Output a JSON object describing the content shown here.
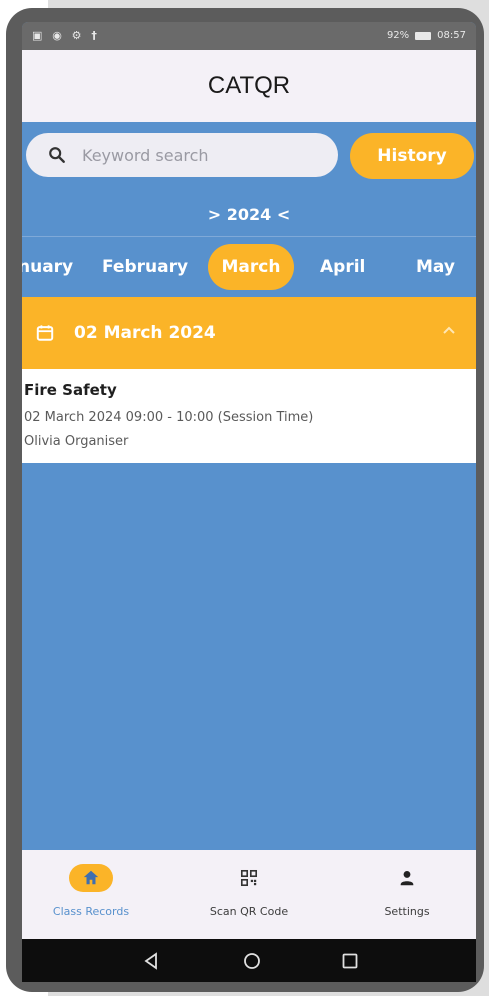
{
  "statusbar": {
    "left_icons": "▣ ◉ ⚙ †",
    "battery": "92%",
    "time": "08:57"
  },
  "app": {
    "title": "CATQR"
  },
  "search": {
    "placeholder": "Keyword search"
  },
  "history_button": "History",
  "year_selector": "> 2024 <",
  "months": [
    "nuary",
    "February",
    "March",
    "April",
    "May"
  ],
  "selected_month": "March",
  "section": {
    "date": "02 March 2024"
  },
  "record": {
    "title": "Fire Safety",
    "session": "02 March 2024 09:00 - 10:00 (Session Time)",
    "organiser": "Olivia Organiser"
  },
  "bottom_nav": [
    {
      "label": "Class Records",
      "icon": "home-icon",
      "active": true
    },
    {
      "label": "Scan QR Code",
      "icon": "qr-code-icon",
      "active": false
    },
    {
      "label": "Settings",
      "icon": "person-icon",
      "active": false
    }
  ],
  "colors": {
    "accent": "#fbb428",
    "primary": "#5891cd",
    "surface": "#f4f1f7"
  }
}
